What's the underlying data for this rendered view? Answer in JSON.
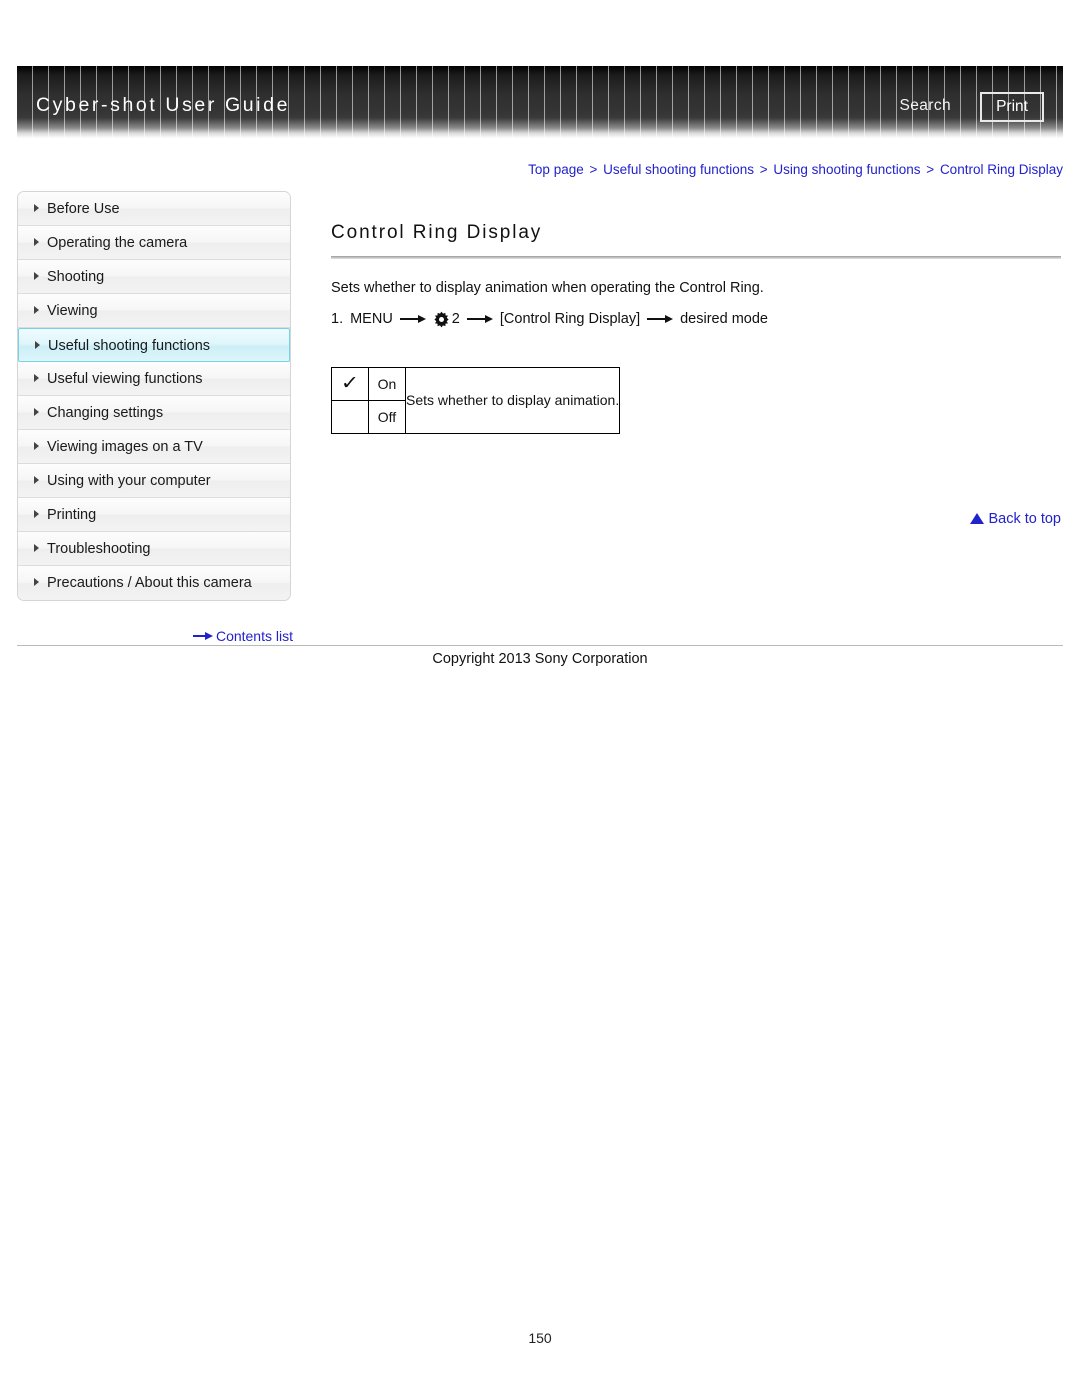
{
  "header": {
    "title": "Cyber-shot User Guide",
    "search_label": "Search",
    "print_label": "Print"
  },
  "breadcrumb": {
    "items": [
      "Top page",
      "Useful shooting functions",
      "Using shooting functions",
      "Control Ring Display"
    ],
    "separator": ">"
  },
  "sidebar": {
    "items": [
      {
        "label": "Before Use",
        "selected": false
      },
      {
        "label": "Operating the camera",
        "selected": false
      },
      {
        "label": "Shooting",
        "selected": false
      },
      {
        "label": "Viewing",
        "selected": false
      },
      {
        "label": "Useful shooting functions",
        "selected": true
      },
      {
        "label": "Useful viewing functions",
        "selected": false
      },
      {
        "label": "Changing settings",
        "selected": false
      },
      {
        "label": "Viewing images on a TV",
        "selected": false
      },
      {
        "label": "Using with your computer",
        "selected": false
      },
      {
        "label": "Printing",
        "selected": false
      },
      {
        "label": "Troubleshooting",
        "selected": false
      },
      {
        "label": "Precautions / About this camera",
        "selected": false
      }
    ],
    "contents_link": "Contents list"
  },
  "main": {
    "title": "Control Ring Display",
    "intro": "Sets whether to display animation when operating the Control Ring.",
    "step": {
      "number": "1.",
      "menu_label": "MENU",
      "gear_number": "2",
      "bracket_label": "[Control Ring Display]",
      "final_label": "desired mode"
    },
    "table": {
      "rows": [
        {
          "check": "✓",
          "label": "On"
        },
        {
          "check": "",
          "label": "Off"
        }
      ],
      "description": "Sets whether to display animation."
    },
    "back_to_top": "Back to top"
  },
  "footer": {
    "copyright": "Copyright 2013 Sony Corporation",
    "page_number": "150"
  },
  "colors": {
    "link": "#2222cc",
    "selected_border": "#77d3e4",
    "header_text": "#ffffff"
  }
}
